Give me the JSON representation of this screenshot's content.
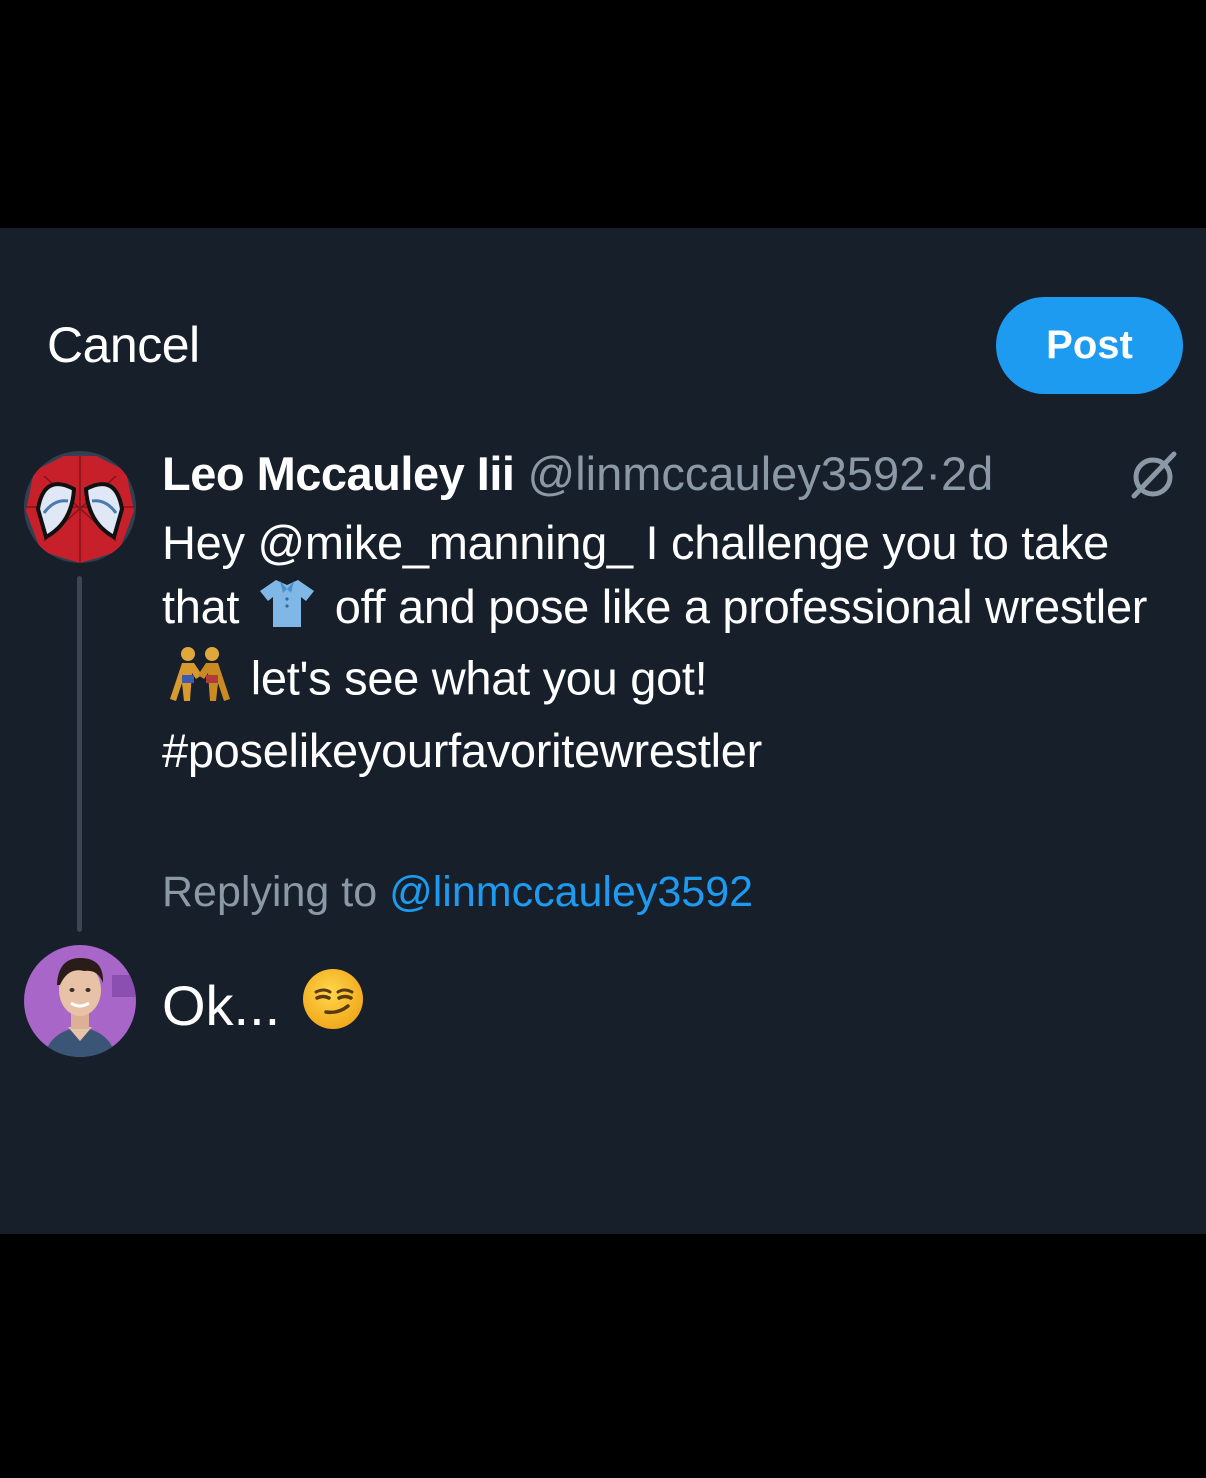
{
  "header": {
    "cancel_label": "Cancel",
    "post_label": "Post"
  },
  "original_post": {
    "author_name": "Leo Mccauley Iii",
    "author_handle": "@linmccauley3592",
    "separator": "·",
    "age": "2d",
    "text_part1": "Hey @mike_manning_  I challenge you to take that",
    "text_part2": "off and pose like a professional wrestler",
    "text_part3": "let's see what you got!",
    "hashtag": "#poselikeyourfavoritewrestler",
    "emoji_1": "shirt-emoji",
    "emoji_2": "wrestlers-emoji"
  },
  "reply": {
    "replying_to_label": "Replying to",
    "replying_to_handle": "@linmccauley3592",
    "draft_text": "Ok...",
    "draft_emoji": "smirking-face-emoji"
  },
  "colors": {
    "background": "#161f2a",
    "accent": "#1d9bf0",
    "secondary_text": "#8b98a5"
  }
}
